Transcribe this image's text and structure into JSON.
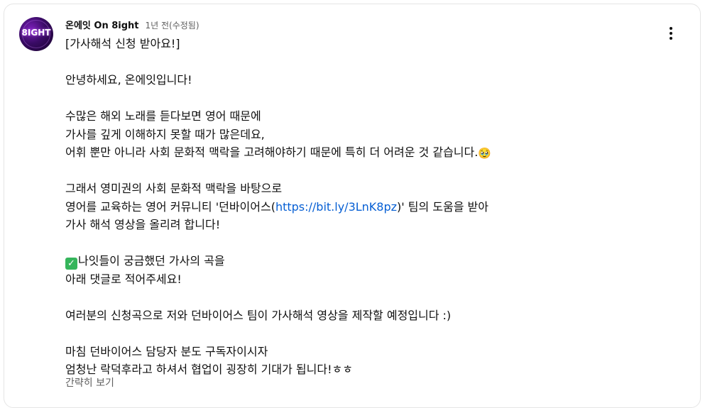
{
  "comment": {
    "author": "온에잇 On 8ight",
    "timestamp": "1년 전(수정됨)",
    "avatar_text": "8IGHT",
    "menu_icon": "more-vertical-icon",
    "show_less_label": "간략히 보기",
    "lines": {
      "l1": "[가사해석 신청 받아요!]",
      "l3": "안녕하세요, 온에잇입니다!",
      "l5": "수많은 해외 노래를 듣다보면 영어 때문에",
      "l6": "가사를 깊게 이해하지 못할 때가 많은데요,",
      "l7": "어휘 뿐만 아니라 사회 문화적 맥락을 고려해야하기 때문에 특히 더 어려운 것 같습니다.",
      "l7_emoji": "🥹",
      "l9": "그래서 영미권의 사회 문화적 맥락을 바탕으로",
      "l10_before": "영어를 교육하는 영어 커뮤니티 '던바이어스(",
      "l10_link": "https://bit.ly/3LnK8pz",
      "l10_after": ")' 팀의 도움을 받아",
      "l11": "가사 해석 영상을 올리려 합니다!",
      "l13_check": "✓",
      "l13": "나잇들이 궁금했던 가사의 곡을",
      "l14": "아래 댓글로 적어주세요!",
      "l16": "여러분의 신청곡으로 저와 던바이어스 팀이 가사해석 영상을 제작할 예정입니다 :)",
      "l18": "마침 던바이어스 담당자 분도 구독자이시자",
      "l19": "엄청난 락덕후라고 하셔서 협업이 굉장히 기대가 됩니다!ㅎㅎ"
    },
    "colors": {
      "link": "#065fd4",
      "secondary_text": "#606060",
      "check_badge": "#35b55b"
    }
  }
}
